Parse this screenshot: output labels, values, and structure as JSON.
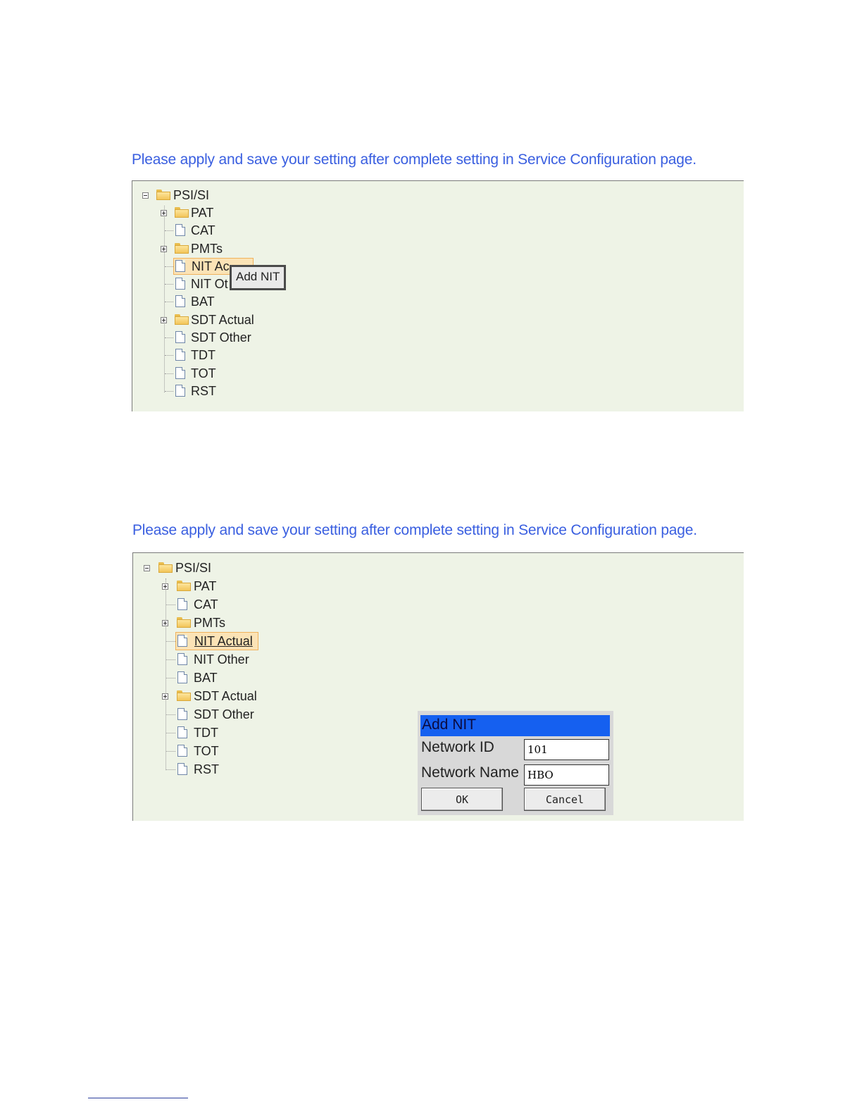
{
  "notice_top": "Please apply and save your setting after complete setting in Service Configuration page.",
  "notice_bottom": "Please apply and save your setting after complete setting in Service Configuration page.",
  "tree": {
    "root": "PSI/SI",
    "items": [
      "PAT",
      "CAT",
      "PMTs",
      "NIT Actual",
      "NIT Other",
      "BAT",
      "SDT Actual",
      "SDT Other",
      "TDT",
      "TOT",
      "RST"
    ],
    "expandable": [
      true,
      false,
      true,
      false,
      false,
      false,
      true,
      false,
      false,
      false,
      false
    ]
  },
  "top_tree": {
    "selected_label_visible": "NIT Ac",
    "other_label_visible": "NIT Ot",
    "tooltip": "Add NIT"
  },
  "dialog": {
    "title": "Add NIT",
    "network_id_label": "Network ID",
    "network_id_value": "101",
    "network_name_label": "Network Name",
    "network_name_value": "HBO",
    "ok_label": "OK",
    "cancel_label": "Cancel"
  },
  "colors": {
    "notice_text": "#3a5fe0",
    "panel_bg": "#eef3e6",
    "selection_bg": "#fbe3b6",
    "dialog_title_bg": "#1560f0"
  }
}
